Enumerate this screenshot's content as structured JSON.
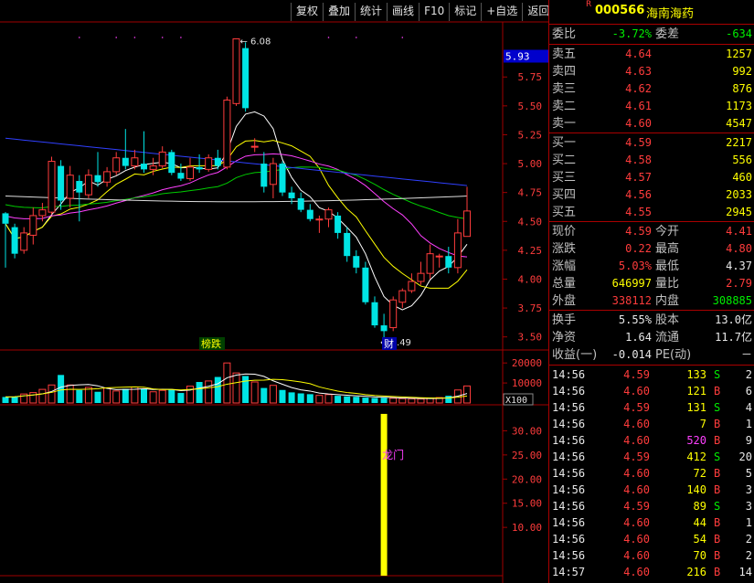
{
  "toolbar": {
    "buttons": [
      "复权",
      "叠加",
      "统计",
      "画线",
      "F10",
      "标记",
      "+自选",
      "返回"
    ]
  },
  "stock": {
    "badge": "R",
    "code": "000566",
    "name": "海南海药"
  },
  "chart_data": [
    {
      "type": "candlestick",
      "y_ticks": [
        "5.75",
        "5.50",
        "5.25",
        "5.00",
        "4.75",
        "4.50",
        "4.25",
        "4.00",
        "3.75",
        "3.50"
      ],
      "ylim": [
        3.45,
        6.1
      ],
      "current_price_tag": "5.93",
      "annotations": {
        "high_label": "6.08",
        "low_label": "3.49",
        "tag_1": "榜跌",
        "tag_2": "财"
      },
      "candles": [
        [
          4.57,
          4.48,
          4.58,
          4.1
        ],
        [
          4.45,
          4.22,
          4.48,
          4.18
        ],
        [
          4.25,
          4.4,
          4.45,
          4.22
        ],
        [
          4.38,
          4.55,
          4.62,
          4.3
        ],
        [
          4.55,
          4.6,
          4.66,
          4.5
        ],
        [
          4.58,
          5.02,
          5.06,
          4.56
        ],
        [
          4.98,
          4.68,
          5.03,
          4.6
        ],
        [
          4.7,
          4.9,
          4.98,
          4.62
        ],
        [
          4.85,
          4.75,
          4.9,
          4.5
        ],
        [
          4.73,
          4.9,
          4.95,
          4.7
        ],
        [
          4.9,
          4.84,
          5.1,
          4.8
        ],
        [
          4.84,
          4.93,
          4.97,
          4.8
        ],
        [
          4.93,
          5.05,
          5.1,
          4.9
        ],
        [
          5.05,
          4.98,
          5.3,
          4.95
        ],
        [
          4.98,
          5.05,
          5.12,
          4.95
        ],
        [
          5.0,
          4.95,
          5.28,
          4.92
        ],
        [
          4.95,
          4.98,
          5.05,
          4.9
        ],
        [
          4.98,
          5.1,
          5.15,
          4.96
        ],
        [
          5.1,
          4.92,
          5.12,
          4.9
        ],
        [
          4.92,
          4.87,
          5.0,
          4.85
        ],
        [
          4.87,
          4.97,
          5.05,
          4.85
        ],
        [
          4.97,
          4.95,
          5.08,
          4.92
        ],
        [
          4.95,
          5.05,
          5.08,
          4.93
        ],
        [
          5.05,
          4.98,
          5.12,
          4.95
        ],
        [
          4.97,
          5.55,
          5.58,
          4.95
        ],
        [
          5.52,
          6.08,
          6.08,
          5.5
        ],
        [
          6.0,
          5.48,
          6.05,
          5.45
        ],
        [
          5.15,
          5.15,
          5.22,
          5.1
        ],
        [
          5.0,
          4.8,
          5.1,
          4.75
        ],
        [
          4.82,
          5.0,
          5.05,
          4.7
        ],
        [
          5.0,
          4.75,
          5.02,
          4.72
        ],
        [
          4.75,
          4.7,
          4.8,
          4.65
        ],
        [
          4.7,
          4.6,
          4.75,
          4.58
        ],
        [
          4.6,
          4.52,
          4.65,
          4.5
        ],
        [
          4.52,
          4.52,
          4.55,
          4.4
        ],
        [
          4.52,
          4.6,
          4.62,
          4.45
        ],
        [
          4.55,
          4.4,
          4.58,
          4.35
        ],
        [
          4.4,
          4.2,
          4.45,
          4.15
        ],
        [
          4.2,
          4.1,
          4.25,
          4.05
        ],
        [
          4.1,
          3.8,
          4.15,
          3.78
        ],
        [
          3.8,
          3.6,
          3.85,
          3.58
        ],
        [
          3.6,
          3.55,
          3.7,
          3.49
        ],
        [
          3.58,
          3.82,
          3.85,
          3.55
        ],
        [
          3.8,
          3.9,
          3.92,
          3.75
        ],
        [
          3.9,
          3.98,
          4.05,
          3.88
        ],
        [
          3.98,
          4.05,
          4.15,
          3.95
        ],
        [
          4.05,
          4.22,
          4.3,
          4.0
        ],
        [
          4.2,
          4.2,
          4.22,
          4.1
        ],
        [
          4.2,
          4.1,
          4.28,
          4.05
        ],
        [
          4.1,
          4.4,
          4.52,
          4.05
        ],
        [
          4.37,
          4.59,
          4.8,
          4.37
        ]
      ]
    },
    {
      "type": "bar",
      "y_ticks": [
        "20000",
        "10000"
      ],
      "scale_label": "X100",
      "values": [
        3000,
        3200,
        4500,
        5200,
        6800,
        9000,
        14000,
        9000,
        6500,
        7800,
        5600,
        7500,
        6000,
        7000,
        8000,
        7200,
        5600,
        6300,
        6800,
        5000,
        8400,
        10500,
        11000,
        13000,
        20000,
        15000,
        13500,
        10500,
        7500,
        8800,
        6500,
        5300,
        4800,
        4400,
        3800,
        4200,
        3600,
        3300,
        3100,
        2700,
        2500,
        2600,
        2400,
        2200,
        2100,
        2000,
        2300,
        2700,
        3600,
        6500,
        8500
      ]
    },
    {
      "type": "bar",
      "y_ticks": [
        "30.00",
        "25.00",
        "20.00",
        "15.00",
        "10.00"
      ],
      "annotation": "龙门",
      "values": [
        {
          "index": 41,
          "value": 33.5
        }
      ]
    }
  ],
  "quote": {
    "weibi": {
      "label": "委比",
      "value": "-3.72%",
      "diff_label": "委差",
      "diff": "-634"
    },
    "asks": [
      {
        "label": "卖五",
        "price": "4.64",
        "vol": "1257"
      },
      {
        "label": "卖四",
        "price": "4.63",
        "vol": "992"
      },
      {
        "label": "卖三",
        "price": "4.62",
        "vol": "876"
      },
      {
        "label": "卖二",
        "price": "4.61",
        "vol": "1173"
      },
      {
        "label": "卖一",
        "price": "4.60",
        "vol": "4547"
      }
    ],
    "bids": [
      {
        "label": "买一",
        "price": "4.59",
        "vol": "2217"
      },
      {
        "label": "买二",
        "price": "4.58",
        "vol": "556"
      },
      {
        "label": "买三",
        "price": "4.57",
        "vol": "460"
      },
      {
        "label": "买四",
        "price": "4.56",
        "vol": "2033"
      },
      {
        "label": "买五",
        "price": "4.55",
        "vol": "2945"
      }
    ],
    "stats1": [
      {
        "l1": "现价",
        "v1": "4.59",
        "c1": "red",
        "l2": "今开",
        "v2": "4.41",
        "c2": "red"
      },
      {
        "l1": "涨跌",
        "v1": "0.22",
        "c1": "red",
        "l2": "最高",
        "v2": "4.80",
        "c2": "red"
      },
      {
        "l1": "涨幅",
        "v1": "5.03%",
        "c1": "red",
        "l2": "最低",
        "v2": "4.37",
        "c2": "wht"
      },
      {
        "l1": "总量",
        "v1": "646997",
        "c1": "yel",
        "l2": "量比",
        "v2": "2.79",
        "c2": "red"
      },
      {
        "l1": "外盘",
        "v1": "338112",
        "c1": "red",
        "l2": "内盘",
        "v2": "308885",
        "c2": "grn"
      }
    ],
    "stats2": [
      {
        "l1": "换手",
        "v1": "5.55%",
        "l2": "股本",
        "v2": "13.0亿"
      },
      {
        "l1": "净资",
        "v1": "1.64",
        "l2": "流通",
        "v2": "11.7亿"
      },
      {
        "l1": "收益(一)",
        "v1": "-0.014",
        "l2": "PE(动)",
        "v2": "－"
      }
    ],
    "colors": {
      "up": "#ff3c3c",
      "down": "#00ee00",
      "neutral": "#e8e8e8",
      "volume": "#ffff00"
    }
  },
  "trades": [
    {
      "time": "14:56",
      "price": "4.59",
      "vol": "133",
      "bs": "S",
      "n": "2"
    },
    {
      "time": "14:56",
      "price": "4.60",
      "vol": "121",
      "bs": "B",
      "n": "6"
    },
    {
      "time": "14:56",
      "price": "4.59",
      "vol": "131",
      "bs": "S",
      "n": "4"
    },
    {
      "time": "14:56",
      "price": "4.60",
      "vol": "7",
      "bs": "B",
      "n": "1"
    },
    {
      "time": "14:56",
      "price": "4.60",
      "vol": "520",
      "bs": "B",
      "n": "9"
    },
    {
      "time": "14:56",
      "price": "4.59",
      "vol": "412",
      "bs": "S",
      "n": "20"
    },
    {
      "time": "14:56",
      "price": "4.60",
      "vol": "72",
      "bs": "B",
      "n": "5"
    },
    {
      "time": "14:56",
      "price": "4.60",
      "vol": "140",
      "bs": "B",
      "n": "3"
    },
    {
      "time": "14:56",
      "price": "4.59",
      "vol": "89",
      "bs": "S",
      "n": "3"
    },
    {
      "time": "14:56",
      "price": "4.60",
      "vol": "44",
      "bs": "B",
      "n": "1"
    },
    {
      "time": "14:56",
      "price": "4.60",
      "vol": "54",
      "bs": "B",
      "n": "2"
    },
    {
      "time": "14:56",
      "price": "4.60",
      "vol": "70",
      "bs": "B",
      "n": "2"
    },
    {
      "time": "14:57",
      "price": "4.60",
      "vol": "216",
      "bs": "B",
      "n": "14"
    }
  ]
}
